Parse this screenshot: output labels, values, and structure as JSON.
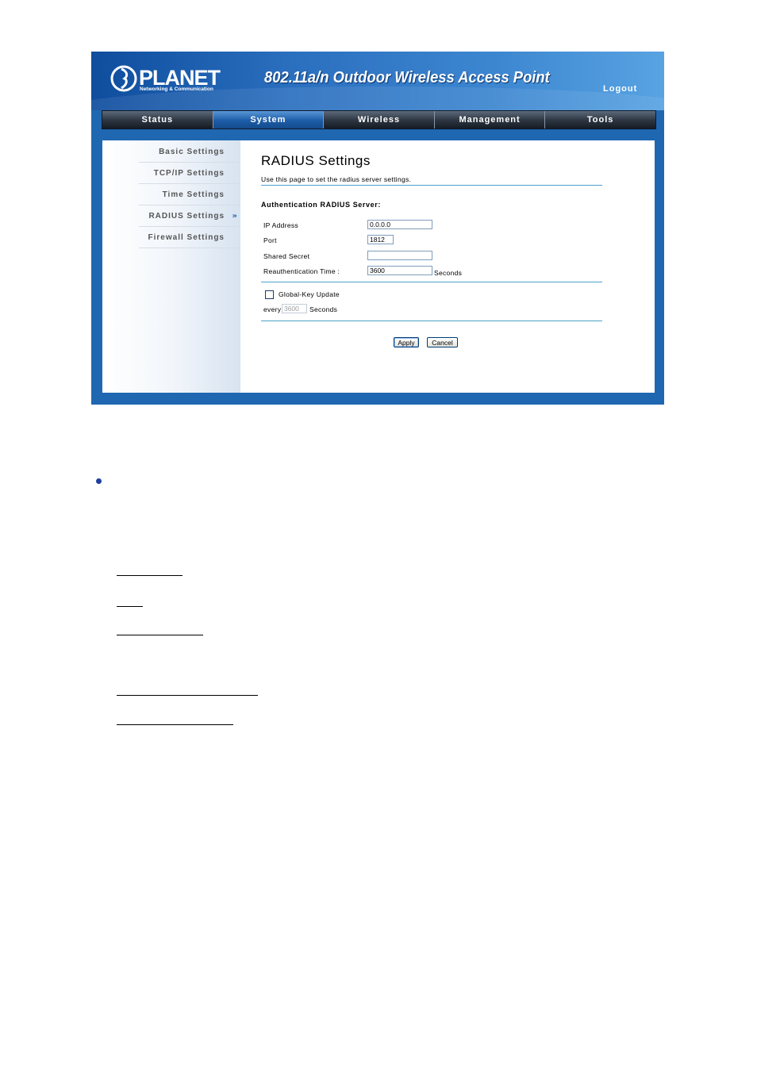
{
  "header": {
    "logo": {
      "name": "PLANET",
      "tagline": "Networking & Communication"
    },
    "product_title": "802.11a/n Outdoor Wireless Access Point",
    "logout_label": "Logout"
  },
  "nav": {
    "tabs": [
      {
        "label": "Status",
        "active": false
      },
      {
        "label": "System",
        "active": true
      },
      {
        "label": "Wireless",
        "active": false
      },
      {
        "label": "Management",
        "active": false
      },
      {
        "label": "Tools",
        "active": false
      }
    ]
  },
  "sidebar": {
    "items": [
      {
        "label": "Basic Settings",
        "active": false
      },
      {
        "label": "TCP/IP Settings",
        "active": false
      },
      {
        "label": "Time Settings",
        "active": false
      },
      {
        "label": "RADIUS Settings",
        "active": true,
        "indicator": "»"
      },
      {
        "label": "Firewall Settings",
        "active": false
      }
    ]
  },
  "main": {
    "title": "RADIUS Settings",
    "description": "Use this page to set the radius server settings.",
    "section_title": "Authentication RADIUS Server:",
    "fields": {
      "ip_address": {
        "label": "IP Address",
        "value": "0.0.0.0"
      },
      "port": {
        "label": "Port",
        "value": "1812"
      },
      "shared_secret": {
        "label": "Shared Secret",
        "value": ""
      },
      "reauth_time": {
        "label": "Reauthentication Time :",
        "value": "3600",
        "unit": "Seconds"
      }
    },
    "global_key": {
      "label": "Global-Key Update",
      "checked": false,
      "every_label": "every",
      "value": "3600",
      "unit": "Seconds"
    },
    "buttons": {
      "apply": "Apply",
      "cancel": "Cancel"
    }
  },
  "colors": {
    "brand_blue": "#1f67b1",
    "rule": "#4aa3c8",
    "bullet": "#1f3f9f"
  }
}
